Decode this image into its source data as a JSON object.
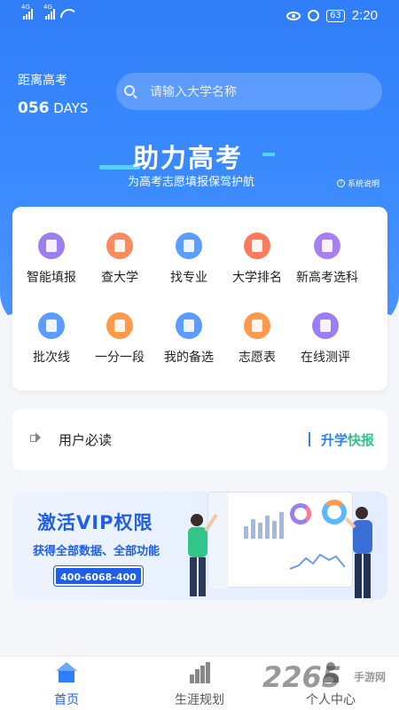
{
  "status_bar": {
    "network_1": "4G",
    "network_2": "4G",
    "battery": "63",
    "time": "2:20"
  },
  "header": {
    "countdown_label": "距离高考",
    "countdown_number": "056",
    "countdown_unit": "DAYS",
    "search_placeholder": "请输入大学名称"
  },
  "hero": {
    "slogan": "助力高考",
    "subslogan": "为高考志愿填报保驾护航",
    "help_label": "系统说明"
  },
  "grid": {
    "items": [
      {
        "label": "智能填报",
        "icon": "smart-fill-icon",
        "color": "#9b7ff0"
      },
      {
        "label": "查大学",
        "icon": "university-icon",
        "color": "#ff8a5c"
      },
      {
        "label": "找专业",
        "icon": "book-icon",
        "color": "#5b9dff"
      },
      {
        "label": "大学排名",
        "icon": "ranking-icon",
        "color": "#ff7a5c"
      },
      {
        "label": "新高考选科",
        "icon": "new-badge-icon",
        "color": "#a77ff0"
      },
      {
        "label": "批次线",
        "icon": "batch-line-icon",
        "color": "#5b9dff"
      },
      {
        "label": "一分一段",
        "icon": "layers-icon",
        "color": "#ff9a4a"
      },
      {
        "label": "我的备选",
        "icon": "envelope-icon",
        "color": "#5b9dff"
      },
      {
        "label": "志愿表",
        "icon": "document-icon",
        "color": "#ff9a4a"
      },
      {
        "label": "在线测评",
        "icon": "assessment-icon",
        "color": "#9b7ff0"
      }
    ]
  },
  "notice": {
    "text": "用户必读",
    "brand_part1": "升学",
    "brand_part2": "快报"
  },
  "vip": {
    "title": "激活VIP权限",
    "subtitle": "获得全部数据、全部功能",
    "phone": "400-6068-400"
  },
  "tabbar": {
    "tabs": [
      {
        "label": "首页",
        "active": true
      },
      {
        "label": "生涯规划",
        "active": false
      },
      {
        "label": "个人中心",
        "active": false
      }
    ]
  },
  "watermark": {
    "number": "2265",
    "text": "手游网"
  },
  "colors": {
    "primary": "#2f7df8",
    "accent_green": "#33c48a",
    "vip_blue": "#1e5ee8"
  }
}
